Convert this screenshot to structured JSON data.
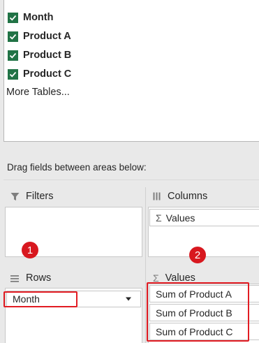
{
  "field_list": {
    "fields": [
      {
        "label": "Month",
        "checked": true
      },
      {
        "label": "Product A",
        "checked": true
      },
      {
        "label": "Product B",
        "checked": true
      },
      {
        "label": "Product C",
        "checked": true
      }
    ],
    "more_tables_label": "More Tables..."
  },
  "instructions": "Drag fields between areas below:",
  "areas": {
    "filters": {
      "label": "Filters",
      "icon": "filter-icon"
    },
    "columns": {
      "label": "Columns",
      "icon": "columns-icon",
      "items": [
        "Values"
      ]
    },
    "rows": {
      "label": "Rows",
      "icon": "rows-icon",
      "items": [
        "Month"
      ]
    },
    "values": {
      "label": "Values",
      "icon": "sigma-icon",
      "items": [
        "Sum of Product A",
        "Sum of Product B",
        "Sum of Product C"
      ]
    }
  },
  "annotations": {
    "badge_1": "1",
    "badge_2": "2",
    "highlight_color": "#e21c23"
  },
  "colors": {
    "checkbox_green": "#217346",
    "background": "#e9e9e9"
  }
}
